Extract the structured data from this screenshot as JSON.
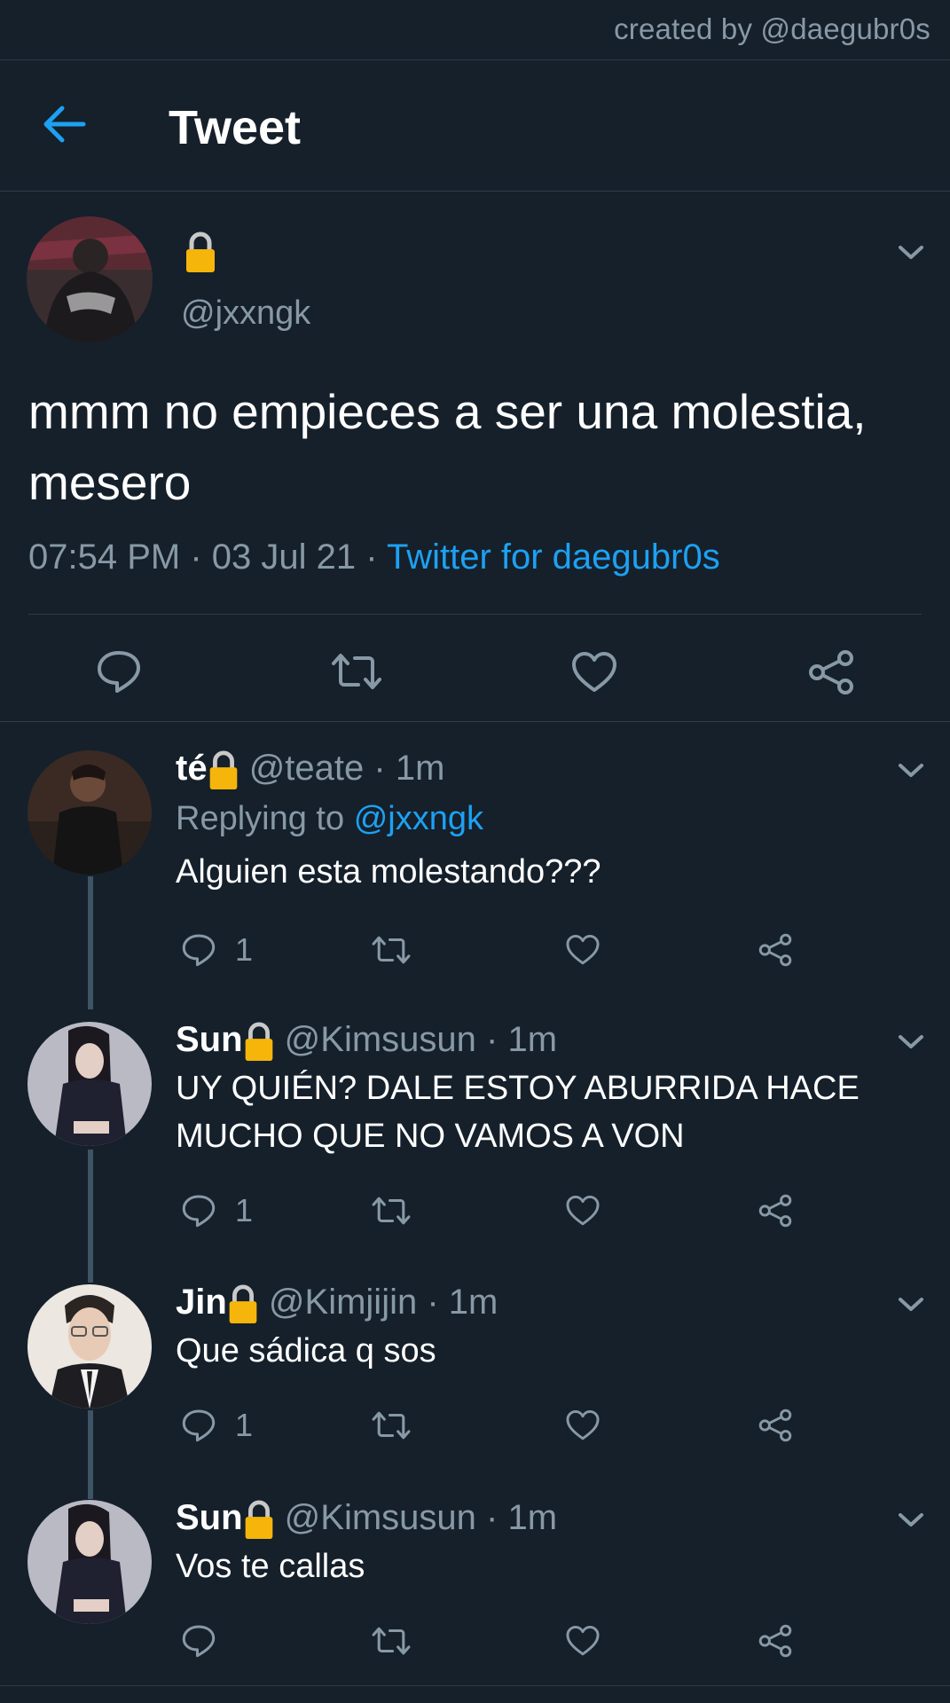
{
  "watermark": "created by @daegubr0s",
  "header": {
    "title": "Tweet"
  },
  "main_tweet": {
    "handle": "@jxxngk",
    "text": "mmm no empieces a ser una molestia, mesero",
    "time": "07:54 PM",
    "date": "03 Jul 21",
    "source": "Twitter for daegubr0s"
  },
  "replies": [
    {
      "name": "té",
      "handle": "@teate",
      "time": "1m",
      "replying_label": "Replying to",
      "replying_to": "@jxxngk",
      "text": "Alguien esta molestando???",
      "reply_count": "1"
    },
    {
      "name": "Sun",
      "handle": "@Kimsusun",
      "time": "1m",
      "text": "UY QUIÉN? DALE ESTOY ABURRIDA HACE MUCHO QUE NO VAMOS A VON",
      "reply_count": "1"
    },
    {
      "name": "Jin",
      "handle": "@Kimjijin",
      "time": "1m",
      "text": "Que sádica q sos",
      "reply_count": "1"
    },
    {
      "name": "Sun",
      "handle": "@Kimsusun",
      "time": "1m",
      "text": "Vos te callas",
      "reply_count": ""
    }
  ],
  "colors": {
    "background": "#15202b",
    "accent": "#1da1f2",
    "secondary_text": "#8899a6",
    "thread_line": "#3d5466",
    "lock": "#f5b50a"
  }
}
